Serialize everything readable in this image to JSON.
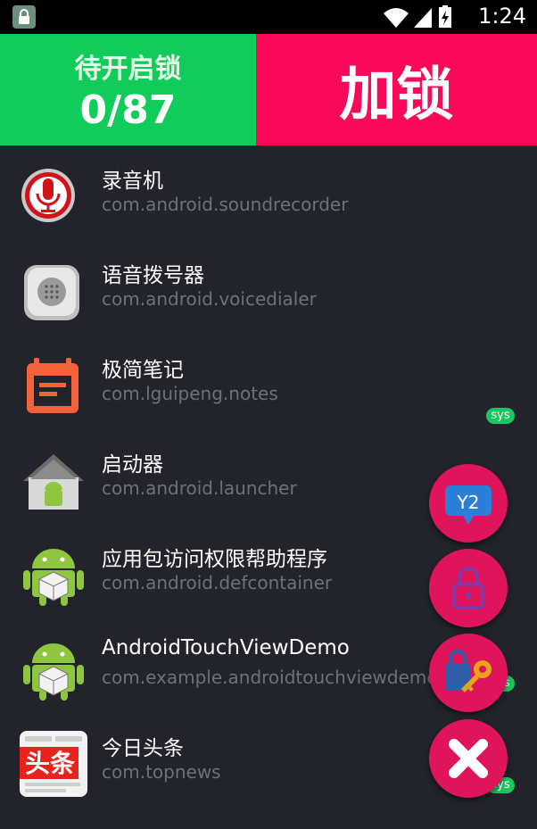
{
  "status_bar": {
    "time": "1:24"
  },
  "header": {
    "pending_label": "待开启锁",
    "pending_count": "0/87",
    "lock_button_label": "加锁"
  },
  "apps": [
    {
      "name": "录音机",
      "package": "com.android.soundrecorder",
      "icon": "sound-recorder-icon"
    },
    {
      "name": "语音拨号器",
      "package": "com.android.voicedialer",
      "icon": "voice-dialer-icon"
    },
    {
      "name": "极简笔记",
      "package": "com.lguipeng.notes",
      "icon": "notes-icon"
    },
    {
      "name": "启动器",
      "package": "com.android.launcher",
      "icon": "launcher-icon"
    },
    {
      "name": "应用包访问权限帮助程序",
      "package": "com.android.defcontainer",
      "icon": "android-package-icon"
    },
    {
      "name": "AndroidTouchViewDemo",
      "package": "com.example.androidtouchviewdemo",
      "icon": "android-package-icon"
    },
    {
      "name": "今日头条",
      "package": "com.topnews",
      "icon": "toutiao-icon"
    }
  ],
  "badges": {
    "sys": "sys"
  },
  "toutiao_logo_text": "头条",
  "colors": {
    "pending_bg": "#11cc5a",
    "lock_bg": "#f8095a",
    "fab_bg": "#e0145a",
    "list_bg": "#22232b"
  }
}
